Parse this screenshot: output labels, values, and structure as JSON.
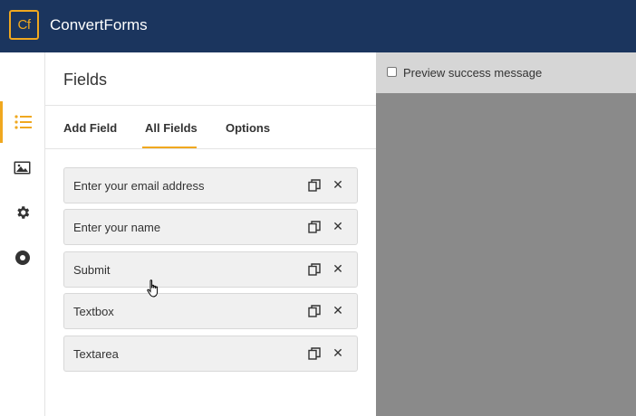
{
  "app": {
    "logo_text": "Cf",
    "title": "ConvertForms"
  },
  "rail": {
    "items": [
      {
        "name": "list-icon",
        "active": true
      },
      {
        "name": "image-icon",
        "active": false
      },
      {
        "name": "gear-icon",
        "active": false
      },
      {
        "name": "circle-dot-icon",
        "active": false
      }
    ]
  },
  "panel": {
    "title": "Fields",
    "tabs": [
      {
        "label": "Add Field",
        "active": false
      },
      {
        "label": "All Fields",
        "active": true
      },
      {
        "label": "Options",
        "active": false
      }
    ],
    "fields": [
      {
        "label": "Enter your email address"
      },
      {
        "label": "Enter your name"
      },
      {
        "label": "Submit"
      },
      {
        "label": "Textbox"
      },
      {
        "label": "Textarea"
      }
    ]
  },
  "preview": {
    "checkbox_label": "Preview success message",
    "checked": false
  },
  "colors": {
    "topbar": "#1b355e",
    "accent": "#f0a81f",
    "preview_bg": "#8a8a8a"
  }
}
